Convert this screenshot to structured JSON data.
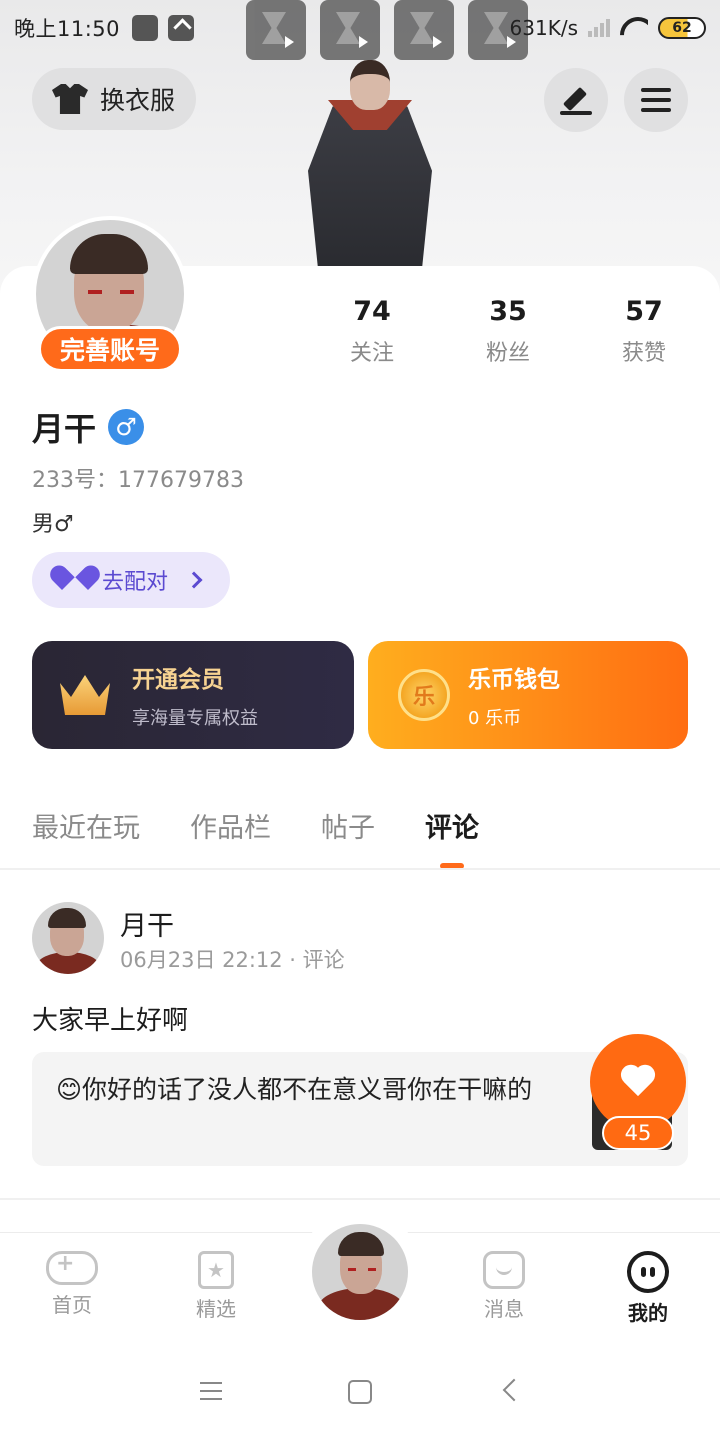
{
  "status_bar": {
    "time": "晚上11:50",
    "network_speed": "631K/s",
    "battery": "62"
  },
  "header": {
    "wardrobe_label": "换衣服"
  },
  "profile": {
    "complete_account_label": "完善账号",
    "name": "月干",
    "gender_symbol": "♂",
    "uid_line": "233号：177679783",
    "bio": "男♂",
    "match_label": "去配对"
  },
  "stats": [
    {
      "value": "74",
      "label": "关注"
    },
    {
      "value": "35",
      "label": "粉丝"
    },
    {
      "value": "57",
      "label": "获赞"
    }
  ],
  "vip_card": {
    "title": "开通会员",
    "subtitle": "享海量专属权益"
  },
  "wallet_card": {
    "coin_char": "乐",
    "title": "乐币钱包",
    "subtitle": "0 乐币"
  },
  "tabs": [
    {
      "label": "最近在玩"
    },
    {
      "label": "作品栏"
    },
    {
      "label": "帖子"
    },
    {
      "label": "评论"
    }
  ],
  "comment": {
    "author": "月干",
    "meta": "06月23日 22:12 · 评论",
    "text": "大家早上好啊",
    "quote": "😊你好的话了没人都不在意义哥你在干嘛的",
    "likes": "45"
  },
  "bottom_nav": [
    {
      "label": "首页"
    },
    {
      "label": "精选"
    },
    {
      "label": "消息"
    },
    {
      "label": "我的"
    }
  ],
  "colors": {
    "accent": "#ff6a1a",
    "vip_bg": "#2a2634",
    "wallet_bg": "#ff8a18",
    "match_bg": "#ebe7fb"
  }
}
